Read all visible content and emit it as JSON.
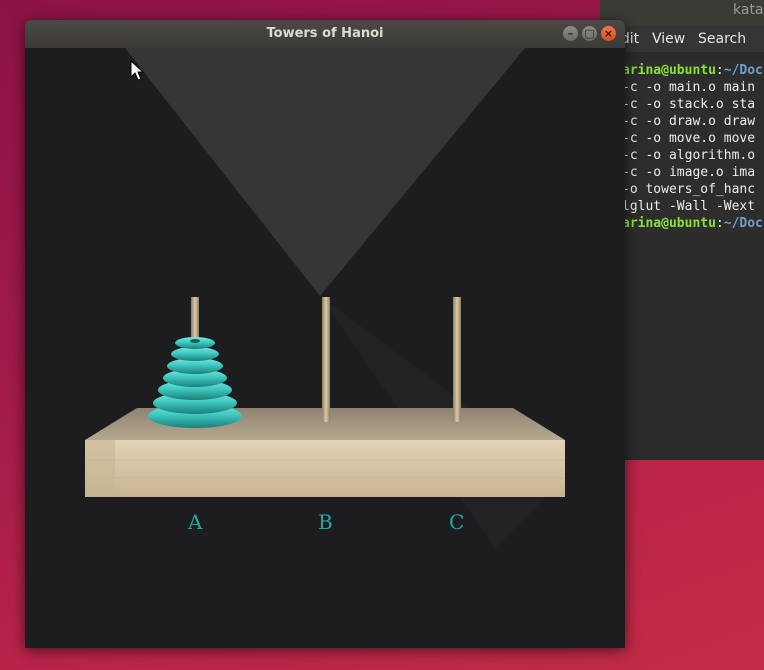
{
  "terminal": {
    "title": "kata",
    "menu": [
      "Edit",
      "View",
      "Search"
    ],
    "prompt_user": "arina@ubuntu",
    "prompt_sep": ":",
    "prompt_path": "~/Doc",
    "lines": [
      "-c -o main.o main",
      "-c -o stack.o sta",
      "-c -o draw.o draw",
      "-c -o move.o move",
      "-c -o algorithm.o",
      "-c -o image.o ima",
      "-o towers_of_hanc",
      "lglut -Wall -Wext"
    ]
  },
  "window": {
    "title": "Towers of Hanoi",
    "buttons": {
      "minimize": "–",
      "maximize": "□",
      "close": "×"
    }
  },
  "game": {
    "pegs": [
      "A",
      "B",
      "C"
    ],
    "disks_on_peg_A": 7,
    "disks_on_peg_B": 0,
    "disks_on_peg_C": 0,
    "disk_color": "#3ec9c0",
    "label_color": "#23a9a0"
  }
}
